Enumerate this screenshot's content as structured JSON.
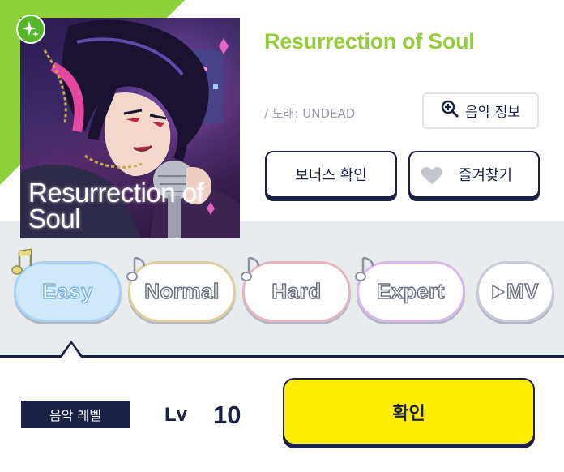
{
  "song": {
    "title": "Resurrection of Soul",
    "jacket_title": "Resurrection of Soul",
    "artist": "/ 노래: UNDEAD"
  },
  "buttons": {
    "music_info": "음악 정보",
    "bonus_check": "보너스 확인",
    "favorite": "즐겨찾기",
    "confirm": "확인"
  },
  "difficulties": [
    {
      "label": "Easy",
      "selected": true
    },
    {
      "label": "Normal",
      "selected": false
    },
    {
      "label": "Hard",
      "selected": false
    },
    {
      "label": "Expert",
      "selected": false
    }
  ],
  "mv_label": "MV",
  "level": {
    "tag": "음악 레벨",
    "prefix": "Lv",
    "value": "10"
  },
  "colors": {
    "accent_green": "#94cc3c",
    "navy": "#1b2144",
    "confirm_yellow": "#ffee00",
    "band_gray": "#e9ecef"
  },
  "icons": [
    "sparkle-icon",
    "magnifier-plus-icon",
    "heart-icon",
    "music-note-icon",
    "play-triangle-icon"
  ]
}
